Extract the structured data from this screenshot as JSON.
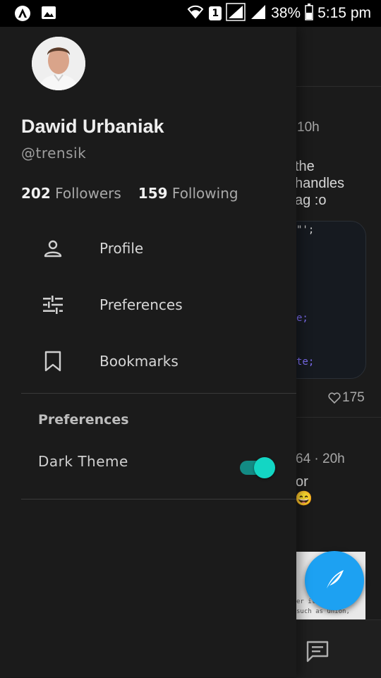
{
  "status_bar": {
    "sim_badge": "1",
    "battery": "38%",
    "time": "5:15 pm"
  },
  "drawer": {
    "name": "Dawid Urbaniak",
    "handle": "@trensik",
    "followers_count": "202",
    "followers_label": "Followers",
    "following_count": "159",
    "following_label": "Following",
    "menu": [
      {
        "label": "Profile",
        "icon": "person-icon"
      },
      {
        "label": "Preferences",
        "icon": "tune-icon"
      },
      {
        "label": "Bookmarks",
        "icon": "bookmark-icon"
      }
    ],
    "section_title": "Preferences",
    "dark_theme_label": "Dark Theme",
    "dark_theme_enabled": true
  },
  "background": {
    "time_1": "10h",
    "body_1": [
      "the",
      "handles",
      "ag :o"
    ],
    "code_1": "\"';",
    "code_2": "e;",
    "code_3": "te;",
    "likes": "175",
    "time_2": "64 · 20h",
    "body_2": "or",
    "emoji": "😄",
    "image_code_1": "er it",
    "image_code_2": " such as union,"
  },
  "colors": {
    "accent": "#13d6c4",
    "fab": "#1da1f2"
  }
}
